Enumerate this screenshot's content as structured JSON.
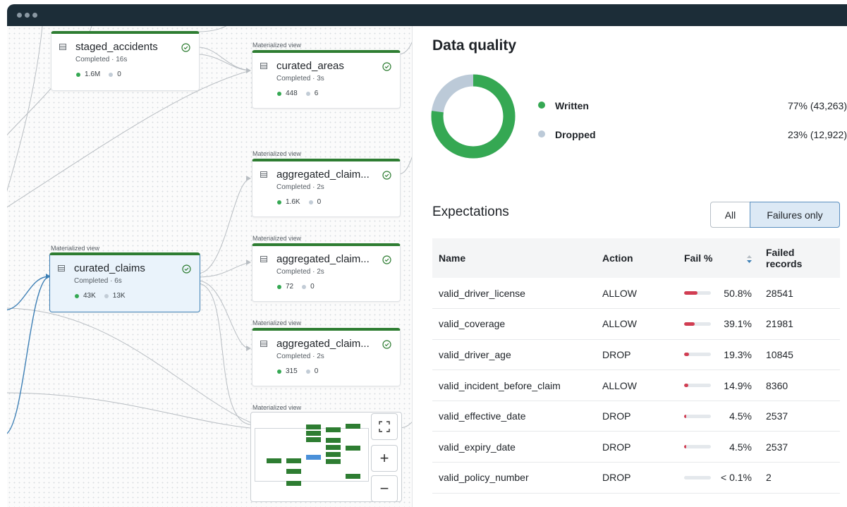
{
  "graph": {
    "nodes": [
      {
        "id": "staged_accidents",
        "label": "",
        "name": "staged_accidents",
        "status": "Completed · 16s",
        "written": "1.6M",
        "dropped": "0"
      },
      {
        "id": "curated_areas",
        "label": "Materialized view",
        "name": "curated_areas",
        "status": "Completed · 3s",
        "written": "448",
        "dropped": "6"
      },
      {
        "id": "agg1",
        "label": "Materialized view",
        "name": "aggregated_claim...",
        "status": "Completed · 2s",
        "written": "1.6K",
        "dropped": "0"
      },
      {
        "id": "curated_claims",
        "label": "Materialized view",
        "name": "curated_claims",
        "status": "Completed · 6s",
        "written": "43K",
        "dropped": "13K"
      },
      {
        "id": "agg2",
        "label": "Materialized view",
        "name": "aggregated_claim...",
        "status": "Completed · 2s",
        "written": "72",
        "dropped": "0"
      },
      {
        "id": "agg3",
        "label": "Materialized view",
        "name": "aggregated_claim...",
        "status": "Completed · 2s",
        "written": "315",
        "dropped": "0"
      }
    ],
    "partial_label": "Materialized view",
    "controls": {
      "fit": "fit-view-icon",
      "zoom_in": "+",
      "zoom_out": "−"
    }
  },
  "data_quality": {
    "title": "Data quality",
    "written_label": "Written",
    "written_value": "77% (43,263)",
    "dropped_label": "Dropped",
    "dropped_value": "23% (12,922)",
    "written_fraction": 0.77,
    "colors": {
      "written": "#35a853",
      "dropped": "#bccad8"
    }
  },
  "expectations": {
    "title": "Expectations",
    "filter_all": "All",
    "filter_failures": "Failures only",
    "columns": {
      "name": "Name",
      "action": "Action",
      "fail": "Fail %",
      "failed_line1": "Failed",
      "failed_line2": "records"
    },
    "rows": [
      {
        "name": "valid_driver_license",
        "action": "ALLOW",
        "fail": "50.8%",
        "fail_fraction": 0.508,
        "records": "28541"
      },
      {
        "name": "valid_coverage",
        "action": "ALLOW",
        "fail": "39.1%",
        "fail_fraction": 0.391,
        "records": "21981"
      },
      {
        "name": "valid_driver_age",
        "action": "DROP",
        "fail": "19.3%",
        "fail_fraction": 0.193,
        "records": "10845"
      },
      {
        "name": "valid_incident_before_claim",
        "action": "ALLOW",
        "fail": "14.9%",
        "fail_fraction": 0.149,
        "records": "8360"
      },
      {
        "name": "valid_effective_date",
        "action": "DROP",
        "fail": "4.5%",
        "fail_fraction": 0.045,
        "records": "2537"
      },
      {
        "name": "valid_expiry_date",
        "action": "DROP",
        "fail": "4.5%",
        "fail_fraction": 0.045,
        "records": "2537"
      },
      {
        "name": "valid_policy_number",
        "action": "DROP",
        "fail": "< 0.1%",
        "fail_fraction": 0.0,
        "records": "2"
      }
    ]
  }
}
